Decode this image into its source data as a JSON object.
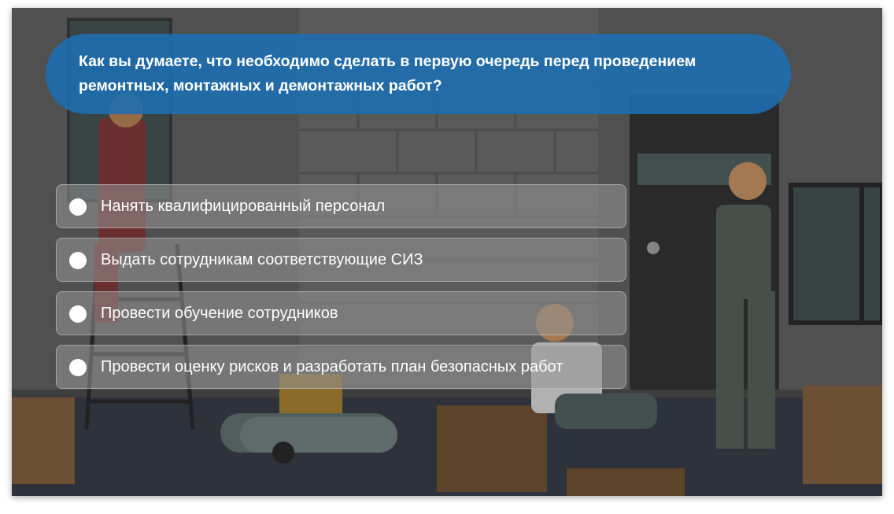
{
  "colors": {
    "bubble": "#1d6eb2",
    "option_bg": "#8f8f8f",
    "text": "#ffffff"
  },
  "question": {
    "line1": "Как вы думаете, что необходимо сделать в первую очередь перед проведением",
    "line2": "ремонтных, монтажных и демонтажных работ?"
  },
  "options": [
    {
      "label": "Нанять квалифицированный персонал",
      "selected": false
    },
    {
      "label": "Выдать сотрудникам соответствующие СИЗ",
      "selected": false
    },
    {
      "label": "Провести обучение сотрудников",
      "selected": false
    },
    {
      "label": "Провести оценку рисков и разработать план безопасных работ",
      "selected": false
    }
  ],
  "background": {
    "scene": "construction-workers-illustration"
  }
}
